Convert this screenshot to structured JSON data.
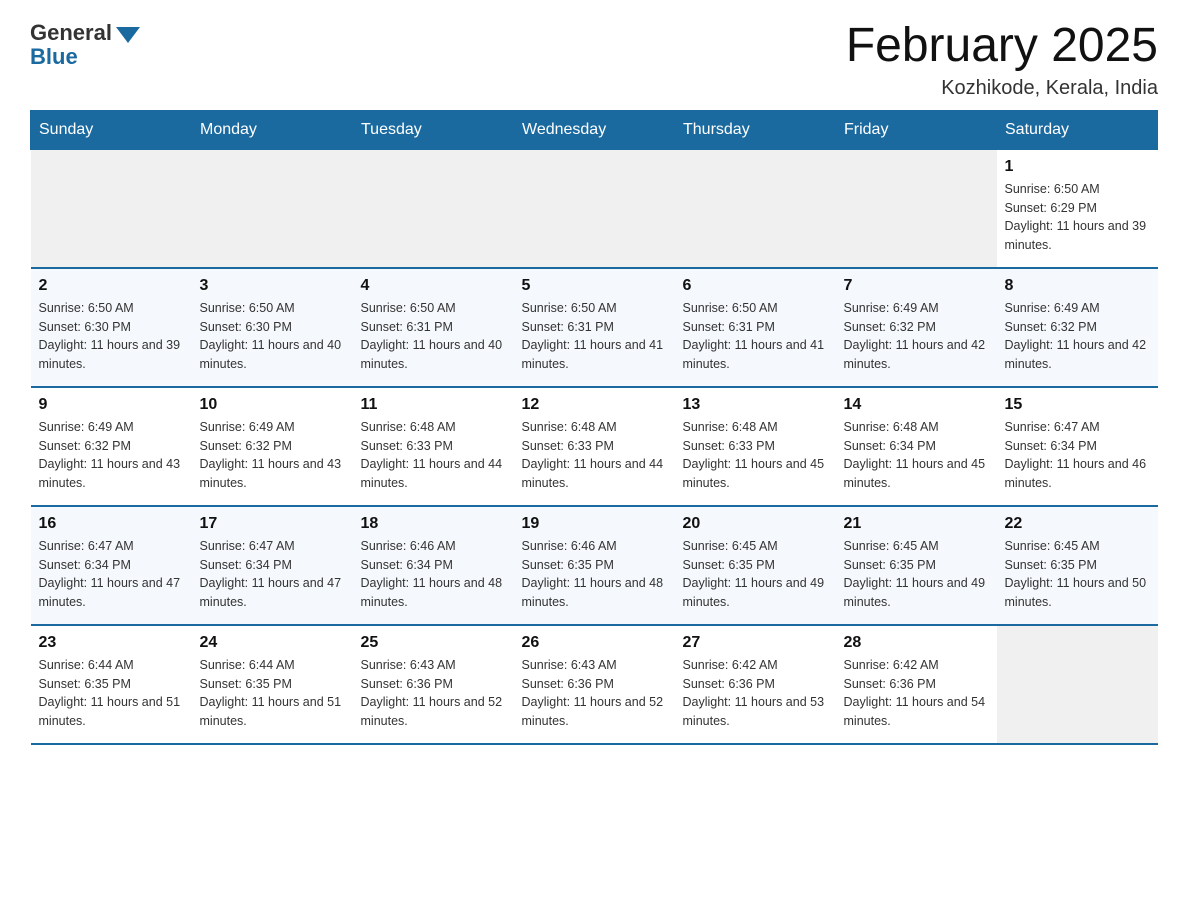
{
  "header": {
    "logo_general": "General",
    "logo_blue": "Blue",
    "month_title": "February 2025",
    "location": "Kozhikode, Kerala, India"
  },
  "days_of_week": [
    "Sunday",
    "Monday",
    "Tuesday",
    "Wednesday",
    "Thursday",
    "Friday",
    "Saturday"
  ],
  "weeks": [
    [
      {
        "day": "",
        "info": ""
      },
      {
        "day": "",
        "info": ""
      },
      {
        "day": "",
        "info": ""
      },
      {
        "day": "",
        "info": ""
      },
      {
        "day": "",
        "info": ""
      },
      {
        "day": "",
        "info": ""
      },
      {
        "day": "1",
        "info": "Sunrise: 6:50 AM\nSunset: 6:29 PM\nDaylight: 11 hours and 39 minutes."
      }
    ],
    [
      {
        "day": "2",
        "info": "Sunrise: 6:50 AM\nSunset: 6:30 PM\nDaylight: 11 hours and 39 minutes."
      },
      {
        "day": "3",
        "info": "Sunrise: 6:50 AM\nSunset: 6:30 PM\nDaylight: 11 hours and 40 minutes."
      },
      {
        "day": "4",
        "info": "Sunrise: 6:50 AM\nSunset: 6:31 PM\nDaylight: 11 hours and 40 minutes."
      },
      {
        "day": "5",
        "info": "Sunrise: 6:50 AM\nSunset: 6:31 PM\nDaylight: 11 hours and 41 minutes."
      },
      {
        "day": "6",
        "info": "Sunrise: 6:50 AM\nSunset: 6:31 PM\nDaylight: 11 hours and 41 minutes."
      },
      {
        "day": "7",
        "info": "Sunrise: 6:49 AM\nSunset: 6:32 PM\nDaylight: 11 hours and 42 minutes."
      },
      {
        "day": "8",
        "info": "Sunrise: 6:49 AM\nSunset: 6:32 PM\nDaylight: 11 hours and 42 minutes."
      }
    ],
    [
      {
        "day": "9",
        "info": "Sunrise: 6:49 AM\nSunset: 6:32 PM\nDaylight: 11 hours and 43 minutes."
      },
      {
        "day": "10",
        "info": "Sunrise: 6:49 AM\nSunset: 6:32 PM\nDaylight: 11 hours and 43 minutes."
      },
      {
        "day": "11",
        "info": "Sunrise: 6:48 AM\nSunset: 6:33 PM\nDaylight: 11 hours and 44 minutes."
      },
      {
        "day": "12",
        "info": "Sunrise: 6:48 AM\nSunset: 6:33 PM\nDaylight: 11 hours and 44 minutes."
      },
      {
        "day": "13",
        "info": "Sunrise: 6:48 AM\nSunset: 6:33 PM\nDaylight: 11 hours and 45 minutes."
      },
      {
        "day": "14",
        "info": "Sunrise: 6:48 AM\nSunset: 6:34 PM\nDaylight: 11 hours and 45 minutes."
      },
      {
        "day": "15",
        "info": "Sunrise: 6:47 AM\nSunset: 6:34 PM\nDaylight: 11 hours and 46 minutes."
      }
    ],
    [
      {
        "day": "16",
        "info": "Sunrise: 6:47 AM\nSunset: 6:34 PM\nDaylight: 11 hours and 47 minutes."
      },
      {
        "day": "17",
        "info": "Sunrise: 6:47 AM\nSunset: 6:34 PM\nDaylight: 11 hours and 47 minutes."
      },
      {
        "day": "18",
        "info": "Sunrise: 6:46 AM\nSunset: 6:34 PM\nDaylight: 11 hours and 48 minutes."
      },
      {
        "day": "19",
        "info": "Sunrise: 6:46 AM\nSunset: 6:35 PM\nDaylight: 11 hours and 48 minutes."
      },
      {
        "day": "20",
        "info": "Sunrise: 6:45 AM\nSunset: 6:35 PM\nDaylight: 11 hours and 49 minutes."
      },
      {
        "day": "21",
        "info": "Sunrise: 6:45 AM\nSunset: 6:35 PM\nDaylight: 11 hours and 49 minutes."
      },
      {
        "day": "22",
        "info": "Sunrise: 6:45 AM\nSunset: 6:35 PM\nDaylight: 11 hours and 50 minutes."
      }
    ],
    [
      {
        "day": "23",
        "info": "Sunrise: 6:44 AM\nSunset: 6:35 PM\nDaylight: 11 hours and 51 minutes."
      },
      {
        "day": "24",
        "info": "Sunrise: 6:44 AM\nSunset: 6:35 PM\nDaylight: 11 hours and 51 minutes."
      },
      {
        "day": "25",
        "info": "Sunrise: 6:43 AM\nSunset: 6:36 PM\nDaylight: 11 hours and 52 minutes."
      },
      {
        "day": "26",
        "info": "Sunrise: 6:43 AM\nSunset: 6:36 PM\nDaylight: 11 hours and 52 minutes."
      },
      {
        "day": "27",
        "info": "Sunrise: 6:42 AM\nSunset: 6:36 PM\nDaylight: 11 hours and 53 minutes."
      },
      {
        "day": "28",
        "info": "Sunrise: 6:42 AM\nSunset: 6:36 PM\nDaylight: 11 hours and 54 minutes."
      },
      {
        "day": "",
        "info": ""
      }
    ]
  ]
}
